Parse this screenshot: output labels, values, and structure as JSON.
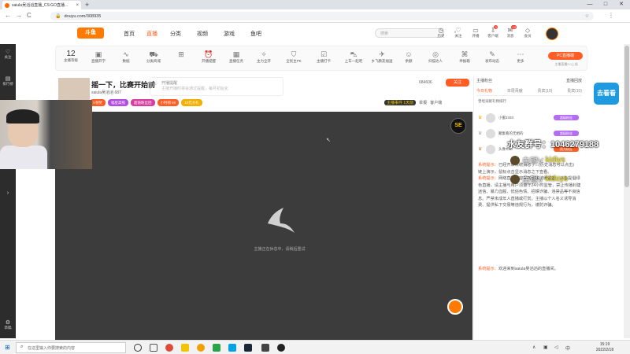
{
  "browser": {
    "tab_title": "saiula吴滔滔直播_CS:GO直播...",
    "tab_close": "×",
    "new_tab": "+",
    "url": "douyu.com/308935",
    "back": "←",
    "forward": "→",
    "reload": "C",
    "win_min": "—",
    "win_max": "□",
    "win_close": "✕"
  },
  "leftrail": {
    "follow": "关注",
    "rank": "排行榜",
    "drafts": "草稿"
  },
  "site": {
    "logo": "斗鱼",
    "nav": [
      "首页",
      "直播",
      "分类",
      "视频",
      "游戏",
      "鱼吧"
    ],
    "search_placeholder": "搜索",
    "header_icons": [
      {
        "label": "历史",
        "icon": "clock-icon"
      },
      {
        "label": "关注",
        "icon": "heart-icon"
      },
      {
        "label": "开播",
        "icon": "camera-icon"
      },
      {
        "label": "客户端",
        "icon": "download-icon"
      },
      {
        "label": "消息",
        "icon": "bell-icon"
      },
      {
        "label": "会员",
        "icon": "diamond-icon"
      }
    ],
    "header_badges": [
      "3",
      "10"
    ]
  },
  "toolbar": {
    "level_num": "12",
    "level_label": "主播等级",
    "items": [
      "直播开学",
      "数据",
      "分类商城",
      "",
      "开播提醒",
      "直播任务",
      "主力全开",
      "全民主PK",
      "主播打卡",
      "上车一起吧",
      "乡飞鹏友福送",
      "余额",
      "扫描达人",
      "举报箱",
      "发布动态",
      "更多"
    ],
    "pc_button": "PC直播端",
    "pc_sub": "主播直播2.0上线"
  },
  "streamer": {
    "title": "摇一下，比赛开始前",
    "owner": "saiula吴滔滔",
    "owner_extra": "687",
    "notice_title": "开播提醒",
    "notice_body": "主播开播时将会通过提醒，每月初始化",
    "fans": "684606",
    "follow_label": "关注",
    "tags": [
      {
        "label": "V领奖",
        "color": "#ff5d23"
      },
      {
        "label": "福星高照",
        "color": "#b14ee0"
      },
      {
        "label": "超值粉丝团",
        "color": "#d63ea0"
      },
      {
        "label": "小时榜 60",
        "color": "#ff5d23"
      },
      {
        "label": "10元大礼",
        "color": "#f2b100"
      }
    ],
    "meta": [
      "主播事件 1天前",
      "举报",
      "客户端"
    ]
  },
  "video": {
    "message": "主播正在休息中，请稍后重试",
    "se_badge": "SE"
  },
  "rightpanel": {
    "head_left": "主播粉丝",
    "head_right": "直播回放",
    "tabs": [
      "今日礼物",
      "本周贡献",
      "贵宾(10)",
      "贵宾(10)"
    ],
    "sub": "曾经贡献礼物排行",
    "rank": [
      {
        "name": "小蜜2333",
        "level": "超级粉丝"
      },
      {
        "name": "聚集看的无相的",
        "level": "超级粉丝"
      },
      {
        "name": "头像Tom",
        "level": "成为粉丝"
      }
    ],
    "chat": [
      {
        "sys": "系统提示：",
        "text": "已经开启系统消息了...(历史消息可以点击)"
      },
      {
        "sys": "",
        "text": "链上演示，鼠标点击显示消息之下查看。"
      },
      {
        "sys": "系统提示：",
        "text": "网络直播内容受到国家法律监管，斗鱼提倡绿色直播，请主播与用户须遵守24小时监管，禁止传播封建迷信、暴力血腥、低俗色情、招嫖诈骗、违禁品等不良信息。严禁未成年人直播或打赏。主播以个人名义诱导消费、提供私下交易等违规行为，谨防诈骗。"
      },
      {
        "sys": "系统提示：",
        "text": "欢迎来到saiula吴滔滔的直播间。"
      }
    ]
  },
  "floats": {
    "headline": "水友群号：1046279188",
    "u1": {
      "prefix": "白银V",
      "name": "kidiys"
    },
    "u2": {
      "prefix": "白银V",
      "name": "kidoys"
    }
  },
  "ad_text": "去看看",
  "taskbar": {
    "search_placeholder": "在这里输入你要搜索的内容",
    "time": "15:19",
    "date": "2022/2/18",
    "lang": "中"
  }
}
